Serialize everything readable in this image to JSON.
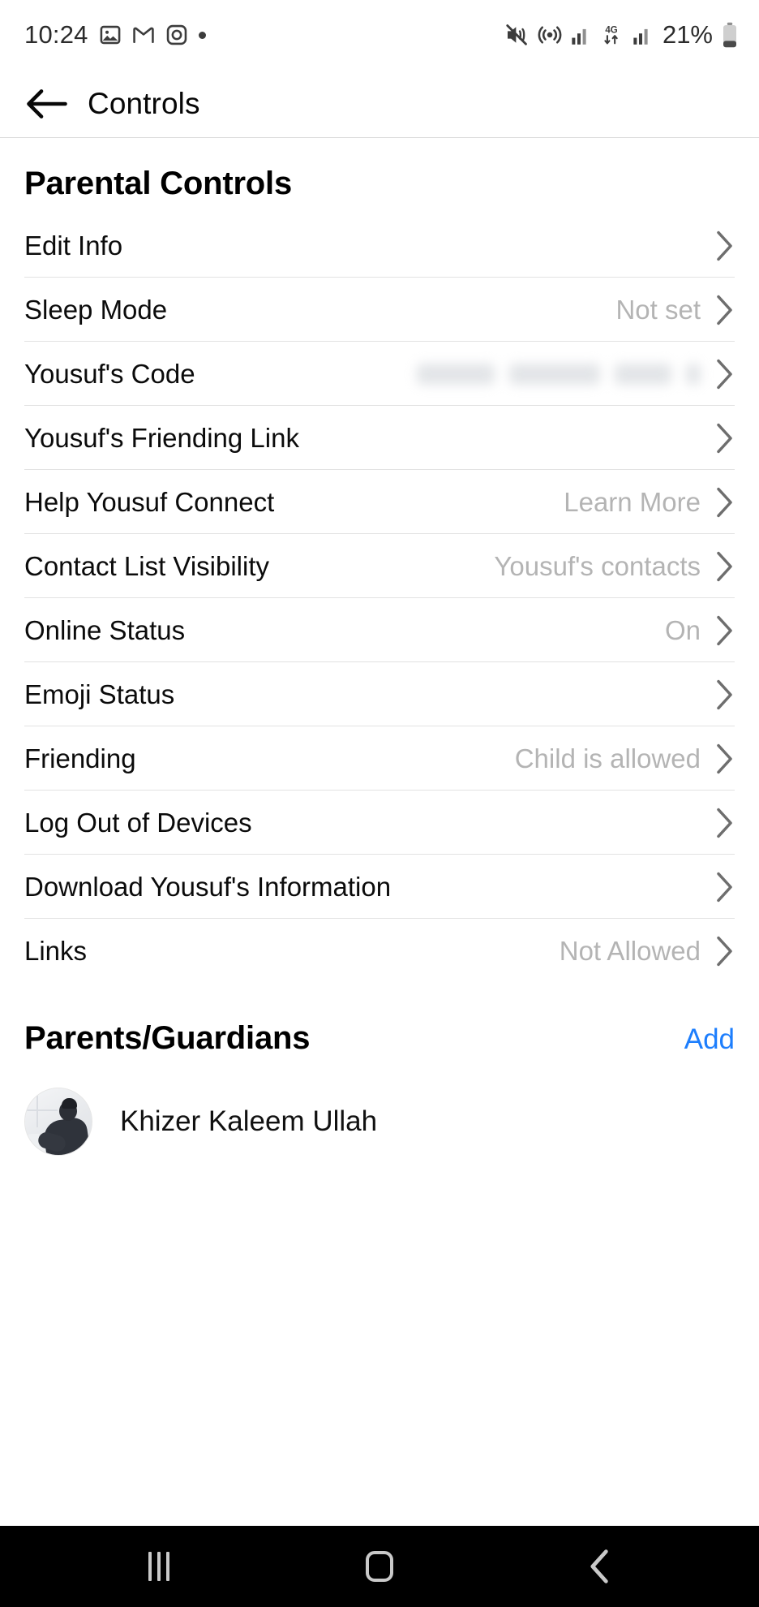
{
  "status_bar": {
    "time": "10:24",
    "left_icons": [
      "gallery-icon",
      "gmail-icon",
      "instagram-icon",
      "dot-indicator"
    ],
    "right_icons": [
      "vibrate-mute-icon",
      "hotspot-icon",
      "signal-bars-icon",
      "4g-data-icon",
      "signal-bars-2-icon"
    ],
    "network_label": "4G",
    "battery_percent": "21%"
  },
  "app_bar": {
    "back_label": "back-arrow",
    "title": "Controls"
  },
  "parental_controls": {
    "section_title": "Parental Controls",
    "rows": [
      {
        "label": "Edit Info",
        "value": "",
        "redacted": false,
        "divider": true
      },
      {
        "label": "Sleep Mode",
        "value": "Not set",
        "redacted": false,
        "divider": true
      },
      {
        "label": "Yousuf's Code",
        "value": "",
        "redacted": true,
        "divider": true
      },
      {
        "label": "Yousuf's Friending Link",
        "value": "",
        "redacted": false,
        "divider": true
      },
      {
        "label": "Help Yousuf Connect",
        "value": "Learn More",
        "redacted": false,
        "divider": true
      },
      {
        "label": "Contact List Visibility",
        "value": "Yousuf's contacts",
        "redacted": false,
        "divider": true
      },
      {
        "label": "Online Status",
        "value": "On",
        "redacted": false,
        "divider": true
      },
      {
        "label": "Emoji Status",
        "value": "",
        "redacted": false,
        "divider": true
      },
      {
        "label": "Friending",
        "value": "Child is allowed",
        "redacted": false,
        "divider": true
      },
      {
        "label": "Log Out of Devices",
        "value": "",
        "redacted": false,
        "divider": true
      },
      {
        "label": "Download Yousuf's Information",
        "value": "",
        "redacted": false,
        "divider": true
      },
      {
        "label": "Links",
        "value": "Not Allowed",
        "redacted": false,
        "divider": false
      }
    ]
  },
  "guardians": {
    "section_title": "Parents/Guardians",
    "add_label": "Add",
    "add_color": "#1d7efd",
    "people": [
      {
        "name": "Khizer Kaleem Ullah",
        "avatar": "guardian-photo"
      }
    ]
  },
  "nav_bar": {
    "buttons": [
      "recents-icon",
      "home-icon",
      "back-icon"
    ]
  },
  "colors": {
    "accent": "#1d7efd",
    "label": "#0b0b0b",
    "value_muted": "#b4b4b4",
    "divider": "#e2e2e2",
    "navbar_bg": "#000000"
  }
}
